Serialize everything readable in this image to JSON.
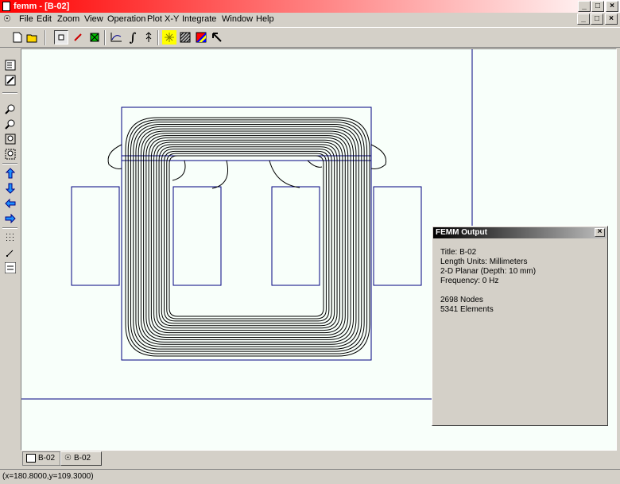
{
  "window": {
    "title": "femm - [B-02]",
    "controls": [
      "_",
      "□",
      "×"
    ]
  },
  "mdi_controls": [
    "_",
    "□",
    "×"
  ],
  "menu": [
    "File",
    "Edit",
    "Zoom",
    "View",
    "Operation",
    "Plot X-Y",
    "Integrate",
    "Window",
    "Help"
  ],
  "toolbar": {
    "new": "new-icon",
    "open": "open-icon",
    "point_mode": "point-mode-icon",
    "contour_mode": "contour-mode-icon",
    "area_mode": "area-mode-icon",
    "plot_xy": "plot-xy-icon",
    "integrate": "integrate-icon",
    "field_icon": "field-icon",
    "density": "density-plot-icon",
    "vector": "vector-plot-icon",
    "color": "color-map-icon",
    "arrow": "arrow-icon"
  },
  "output_window": {
    "title": "FEMM Output",
    "lines": [
      "Title: B-02",
      "Length Units: Millimeters",
      "2-D Planar (Depth: 10 mm)",
      "Frequency: 0 Hz",
      "",
      "2698 Nodes",
      "5341 Elements"
    ]
  },
  "tabs": [
    {
      "label": "B-02",
      "active": false
    },
    {
      "label": "B-02",
      "active": true
    }
  ],
  "status": "(x=180.8000,y=109.3000)",
  "colors": {
    "geometry": "#000080",
    "flux_lines": "#000000",
    "canvas": "#f8fffa",
    "title_red": "#ff0000"
  }
}
